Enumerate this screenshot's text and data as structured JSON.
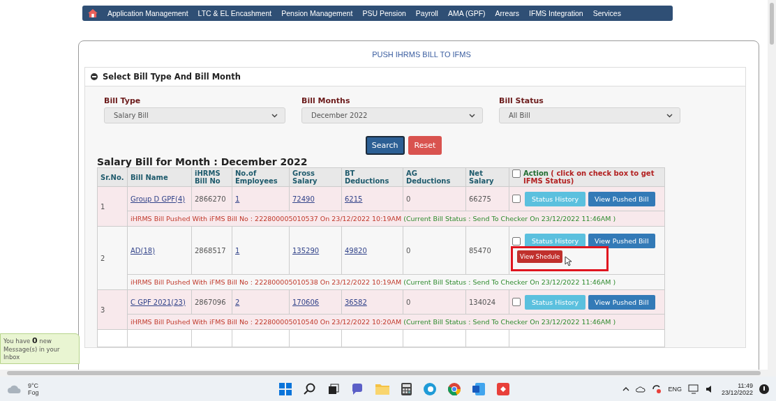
{
  "nav": {
    "items": [
      "Application Management",
      "LTC & EL Encashment",
      "Pension Management",
      "PSU Pension",
      "Payroll",
      "AMA (GPF)",
      "Arrears",
      "IFMS Integration",
      "Services"
    ]
  },
  "card": {
    "title": "PUSH IHRMS BILL TO IFMS"
  },
  "panel": {
    "title": "Select Bill Type And Bill Month",
    "expanded": true
  },
  "filters": [
    {
      "label": "Bill Type",
      "value": "Salary Bill"
    },
    {
      "label": "Bill Months",
      "value": "December 2022"
    },
    {
      "label": "Bill Status",
      "value": "All Bill"
    }
  ],
  "buttons": {
    "search": "Search",
    "reset": "Reset"
  },
  "table": {
    "heading": "Salary Bill for Month : December 2022",
    "columns": [
      "Sr.No.",
      "Bill Name",
      "iHRMS Bill No",
      "No.of Employees",
      "Gross Salary",
      "BT Deductions",
      "AG Deductions",
      "Net Salary"
    ],
    "action_header": {
      "label": "Action",
      "note": "( click on check box to get IFMS Status)",
      "checked": false
    },
    "rows": [
      {
        "sr": "1",
        "name": "Group D GPF(4)",
        "bill_no": "2866270",
        "employees": "1",
        "gross": "72490",
        "bt": "6215",
        "ag": "0",
        "net": "66275",
        "checked": false,
        "buttons": [
          "Status History",
          "View Pushed Bill"
        ],
        "schedule": null,
        "pushed": "iHRMS Bill Pushed With iFMS Bill No : 222800005010537 On 23/12/2022 10:19AM",
        "status": "(Current Bill Status : Send To Checker On 23/12/2022 11:46AM )"
      },
      {
        "sr": "2",
        "name": "AD(18)",
        "bill_no": "2868517",
        "employees": "1",
        "gross": "135290",
        "bt": "49820",
        "ag": "0",
        "net": "85470",
        "checked": false,
        "buttons": [
          "Status History",
          "View Pushed Bill"
        ],
        "schedule": "View Shedule",
        "pushed": "iHRMS Bill Pushed With iFMS Bill No : 222800005010538 On 23/12/2022 10:19AM",
        "status": "(Current Bill Status : Send To Checker On 23/12/2022 11:46AM )"
      },
      {
        "sr": "3",
        "name": "C GPF 2021(23)",
        "bill_no": "2867096",
        "employees": "2",
        "gross": "170606",
        "bt": "36582",
        "ag": "0",
        "net": "134024",
        "checked": false,
        "buttons": [
          "Status History",
          "View Pushed Bill"
        ],
        "schedule": null,
        "pushed": "iHRMS Bill Pushed With iFMS Bill No : 222800005010540 On 23/12/2022 10:20AM",
        "status": "(Current Bill Status : Send To Checker On 23/12/2022 11:46AM )"
      }
    ]
  },
  "inbox": {
    "before": "You have",
    "count": "0",
    "after": "new Message(s) in your Inbox"
  },
  "taskbar": {
    "temperature": "9°C",
    "weather": "Fog",
    "language": "ENG",
    "time": "11:49",
    "date": "23/12/2022"
  }
}
